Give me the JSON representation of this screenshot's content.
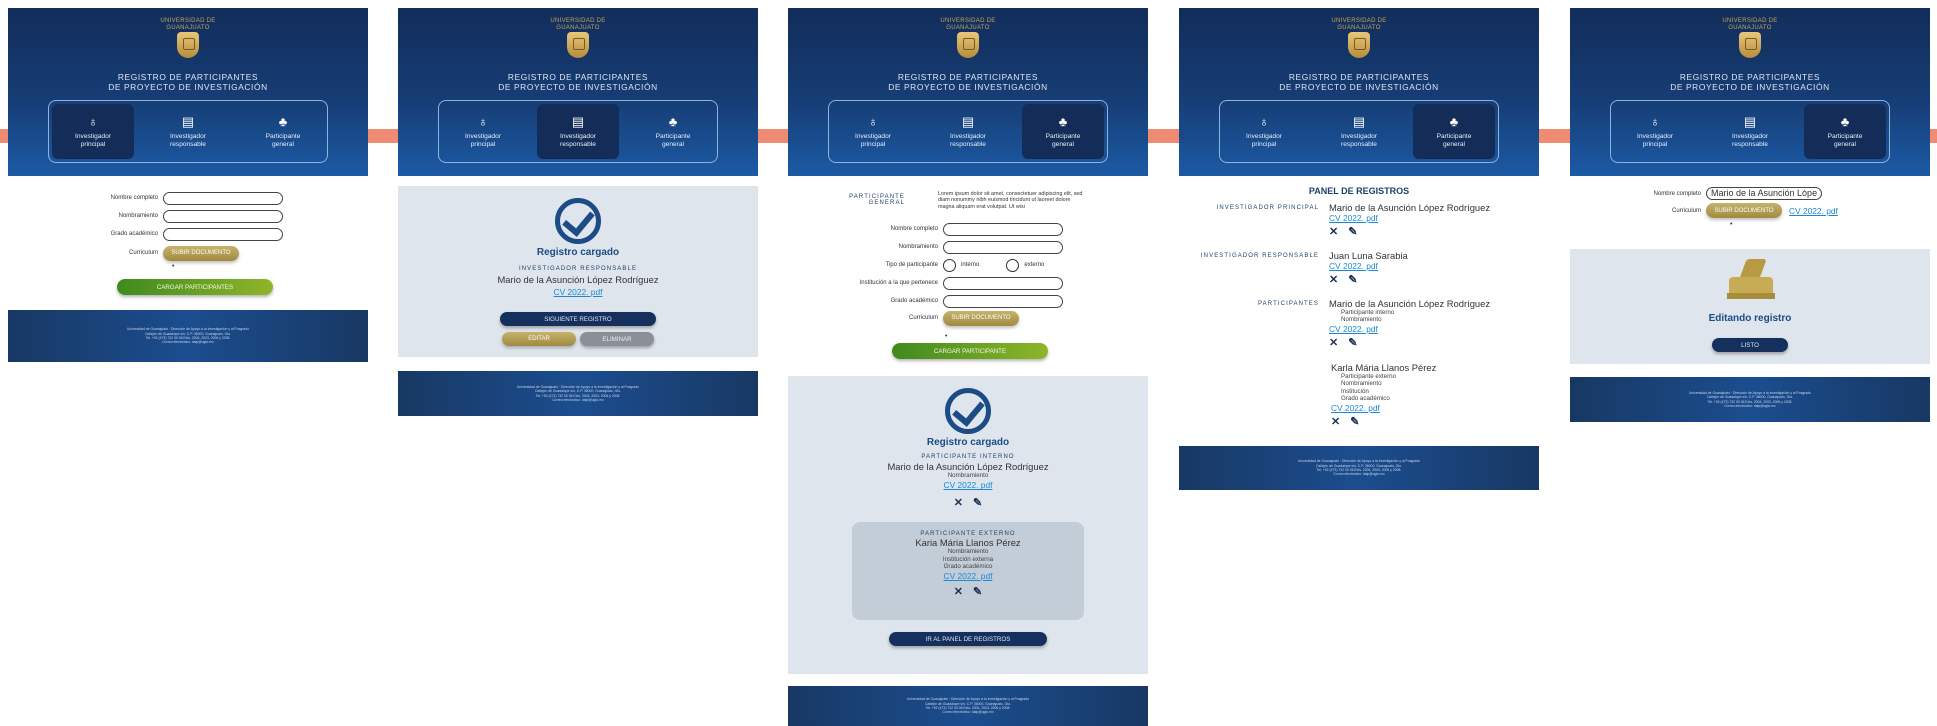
{
  "header": {
    "university": [
      "UNIVERSIDAD DE",
      "GUANAJUATO"
    ],
    "title": [
      "REGISTRO DE PARTICIPANTES",
      "DE PROYECTO DE INVESTIGACIÓN"
    ],
    "tabs": [
      {
        "line1": "Investigador",
        "line2": "principal",
        "icon": "user-search-icon"
      },
      {
        "line1": "Investigador",
        "line2": "responsable",
        "icon": "document-icon"
      },
      {
        "line1": "Participante",
        "line2": "general",
        "icon": "group-icon"
      }
    ]
  },
  "footer": [
    "Universidad de Guanajuato · Dirección de Apoyo a la Investigación y al Posgrado",
    "Callejón de Guadalupe s/n, C.P. 36000, Guanajuato, Gto.",
    "Tel. +52 (473) 732 00 06 Exts. 2004, 2003, 2006 y 2008.",
    "Correo electrónico: daip@ugto.mx"
  ],
  "labels": {
    "full_name": "Nombre completo",
    "appointment": "Nombramiento",
    "academic_degree": "Grado académico",
    "curriculum": "Curriculum",
    "upload_doc": "SUBIR DOCUMENTO",
    "load_participants": "CARGAR PARTICIPANTES",
    "load_participant": "CARGAR PARTICIPANTE",
    "participant_type": "Tipo de participante",
    "internal": "interno",
    "external": "externo",
    "institution": "Institución a la que pertenece",
    "general_participant": "PARTICIPANTE GENERAL",
    "lorem": "Lorem ipsum dolor sit amet, consectetuer adipiscing elit, sed diam nonummy nibh euismod tincidunt ut laoreet dolore magna aliquam erat volutpat. Ut wisi",
    "loaded": "Registro cargado",
    "next_record": "SIGUIENTE REGISTRO",
    "edit": "EDITAR",
    "delete": "ELIMINAR",
    "responsible_researcher": "INVESTIGADOR RESPONSABLE",
    "internal_participant": "PARTICIPANTE INTERNO",
    "external_participant": "PARTICIPANTE EXTERNO",
    "go_panel": "IR AL PANEL DE REGISTROS",
    "panel_title": "PANEL DE REGISTROS",
    "principal_researcher": "INVESTIGADOR PRINCIPAL",
    "participants": "PARTICIPANTES",
    "editing": "Editando registro",
    "done": "LISTO",
    "sub_internal": "Participante interno",
    "sub_external": "Participante externo",
    "inst": "Institución",
    "inst_external": "Institución externa"
  },
  "people": {
    "mario": "Mario de la Asunción López Rodríguez",
    "mario_short": "Mario de la Asunción Lópe",
    "juan": "Juan Luna Sarabia",
    "karla": "Karla Mária Llanos Pérez",
    "karia": "Karia Mária Llanos Pérez",
    "cv": "CV 2022. pdf"
  },
  "colors": {
    "navy": "#15305c",
    "accent_connector": "#ee8b72",
    "gold": "#b39a4f",
    "green": "#5e9b22",
    "link": "#1a8ad6"
  }
}
